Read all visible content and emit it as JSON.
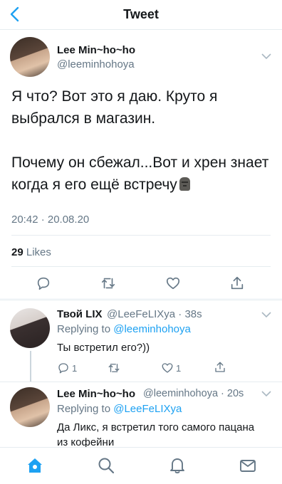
{
  "nav": {
    "title": "Tweet",
    "back_icon": "back-chevron-icon"
  },
  "tweet": {
    "author_name": "Lee Min~ho~ho",
    "author_handle": "@leeminhohoya",
    "lines": [
      "Я что? Вот это я даю. Круто я выбрался в магазин.",
      "Почему он сбежал...Вот и хрен знает когда я его ещё встречу"
    ],
    "emoji": "moai-icon",
    "timestamp": "20:42 · 20.08.20",
    "likes_count": "29",
    "likes_label": "Likes",
    "actions": [
      "reply-icon",
      "retweet-icon",
      "like-icon",
      "share-icon"
    ]
  },
  "replies": [
    {
      "author_name": "Твой LIX",
      "author_handle": "@LeeFeLIXya",
      "time": "· 38s",
      "replying_prefix": "Replying to",
      "replying_handle": "@leeminhohoya",
      "text": "Ты встретил его?))",
      "reply_count": "1",
      "like_count": "1"
    },
    {
      "author_name": "Lee Min~ho~ho",
      "author_handle": "@leeminhohoya",
      "time": "· 20s",
      "replying_prefix": "Replying to",
      "replying_handle": "@LeeFeLIXya",
      "text": "Да Ликс, я встретил того самого пацана из кофейни"
    }
  ],
  "tabbar": [
    "home-icon",
    "search-icon",
    "notifications-icon",
    "messages-icon"
  ],
  "colors": {
    "accent": "#1da1f2",
    "muted": "#657786",
    "text": "#14171a",
    "border": "#e6ecf0"
  }
}
